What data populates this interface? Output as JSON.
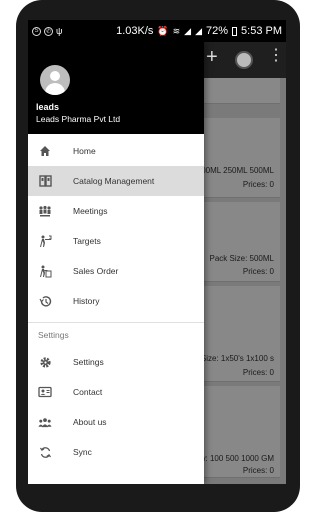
{
  "status_bar": {
    "speed": "1.03K/s",
    "battery": "72%",
    "time": "5:53 PM"
  },
  "app_bar": {
    "add_symbol": "+",
    "more_symbol": "⋮"
  },
  "background_cards": [
    {
      "line1": "",
      "line2": ""
    },
    {
      "line1": "00ML 250ML 500ML",
      "line2": "Prices: 0"
    },
    {
      "line1": "Pack Size: 500ML",
      "line2": "Prices: 0"
    },
    {
      "line1": "Size: 1x50's 1x100 s",
      "line2": "Prices: 0"
    },
    {
      "line1": "w: 100 500 1000 GM",
      "line2": "Prices: 0"
    }
  ],
  "drawer": {
    "user_name": "leads",
    "user_org": "Leads Pharma Pvt Ltd",
    "items": [
      {
        "label": "Home",
        "icon": "home-icon"
      },
      {
        "label": "Catalog Management",
        "icon": "catalog-icon"
      },
      {
        "label": "Meetings",
        "icon": "meetings-icon"
      },
      {
        "label": "Targets",
        "icon": "targets-icon"
      },
      {
        "label": "Sales Order",
        "icon": "sales-order-icon"
      },
      {
        "label": "History",
        "icon": "history-icon"
      }
    ],
    "section_title": "Settings",
    "settings_items": [
      {
        "label": "Settings",
        "icon": "gear-icon"
      },
      {
        "label": "Contact",
        "icon": "contact-card-icon"
      },
      {
        "label": "About us",
        "icon": "group-icon"
      },
      {
        "label": "Sync",
        "icon": "sync-icon"
      }
    ],
    "active_index": 1
  }
}
